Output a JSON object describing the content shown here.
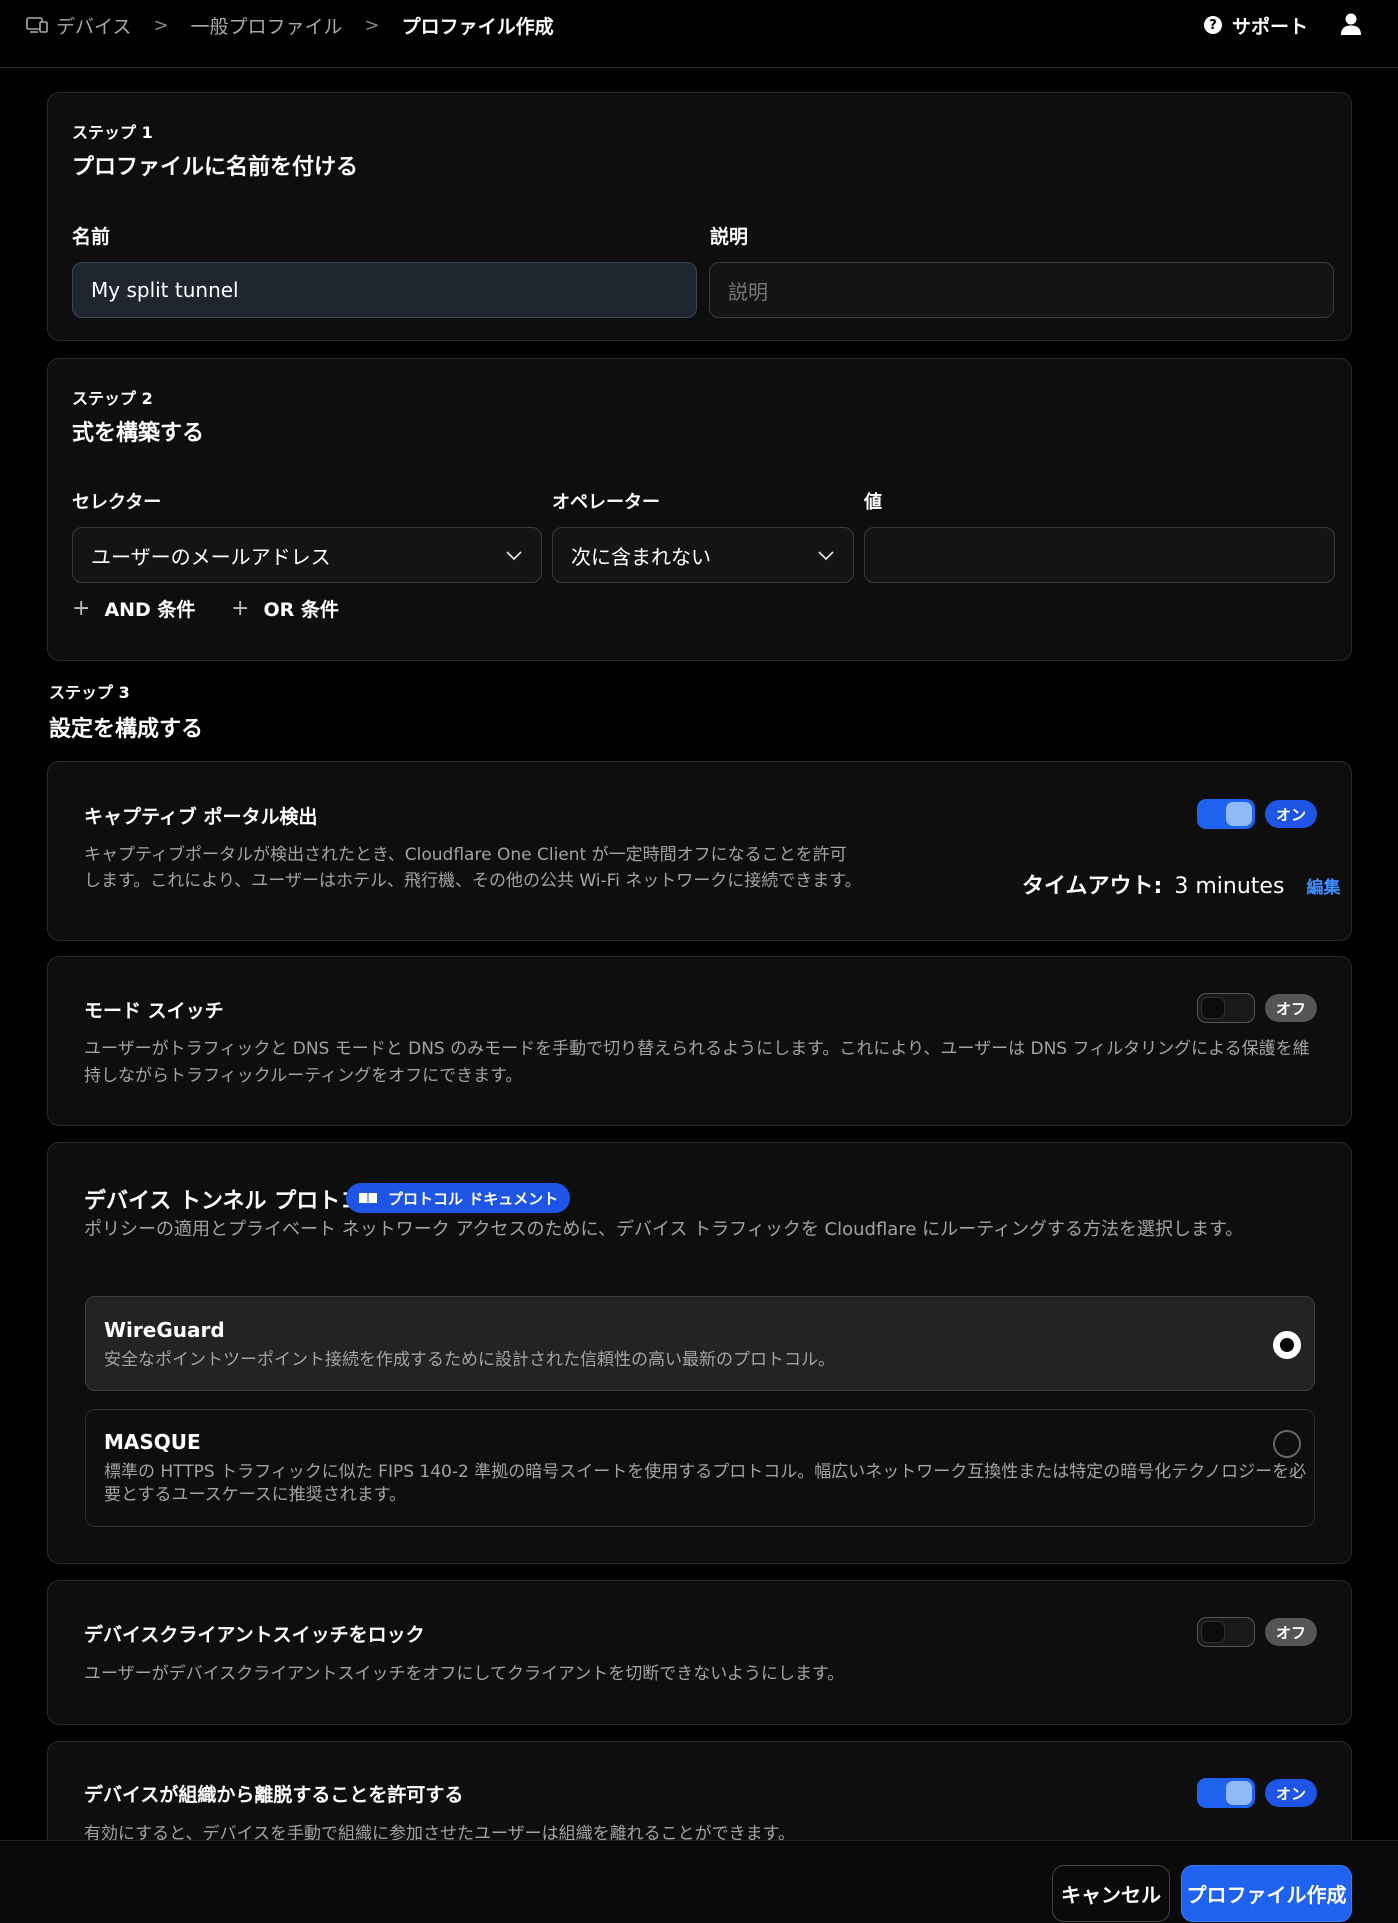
{
  "breadcrumb": {
    "items": [
      "デバイス",
      "一般プロファイル",
      "プロファイル作成"
    ],
    "separator": ">"
  },
  "header": {
    "support_label": "サポート",
    "support_icon": "?"
  },
  "step1": {
    "label": "ステップ 1",
    "title": "プロファイルに名前を付ける",
    "name_label": "名前",
    "name_value": "My split tunnel",
    "desc_label": "説明",
    "desc_placeholder": "説明"
  },
  "step2": {
    "label": "ステップ 2",
    "title": "式を構築する",
    "selector_label": "セレクター",
    "selector_value": "ユーザーのメールアドレス",
    "operator_label": "オペレーター",
    "operator_value": "次に含まれない",
    "value_label": "値",
    "value_value": "",
    "and_label": "AND 条件",
    "or_label": "OR 条件",
    "plus": "+"
  },
  "step3": {
    "label": "ステップ 3",
    "title": "設定を構成する"
  },
  "captive": {
    "title": "キャプティブ ポータル検出",
    "desc_line1": "キャプティブポータルが検出されたとき、Cloudflare One Client が一定時間オフになることを許可",
    "desc_line2": "します。これにより、ユーザーはホテル、飛行機、その他の公共 Wi-Fi ネットワークに接続できます。",
    "state": "オン",
    "timeout_label": "タイムアウト:",
    "timeout_value": "3 minutes",
    "edit_label": "編集"
  },
  "mode_switch": {
    "title": "モード スイッチ",
    "desc_line1": "ユーザーがトラフィックと DNS モードと DNS のみモードを手動で切り替えられるようにします。これにより、ユーザーは DNS フィルタリングによる保護を維",
    "desc_line2": "持しながらトラフィックルーティングをオフにできます。",
    "state": "オフ"
  },
  "protocol": {
    "title": "デバイス トンネル プロトコル",
    "doc_badge": "プロトコル ドキュメント",
    "desc": "ポリシーの適用とプライベート ネットワーク アクセスのために、デバイス トラフィックを Cloudflare にルーティングする方法を選択します。",
    "options": [
      {
        "name": "WireGuard",
        "desc_line1": "安全なポイントツーポイント接続を作成するために設計された信頼性の高い最新のプロトコル。",
        "desc_line2": "",
        "selected": true
      },
      {
        "name": "MASQUE",
        "desc_line1": "標準の HTTPS トラフィックに似た FIPS 140-2 準拠の暗号スイートを使用するプロトコル。幅広いネットワーク互換性または特定の暗号化テクノロジーを必",
        "desc_line2": "要とするユースケースに推奨されます。",
        "selected": false
      }
    ]
  },
  "lock_switch": {
    "title": "デバイスクライアントスイッチをロック",
    "desc": "ユーザーがデバイスクライアントスイッチをオフにしてクライアントを切断できないようにします。",
    "state": "オフ"
  },
  "leave_org": {
    "title": "デバイスが組織から離脱することを許可する",
    "desc": "有効にすると、デバイスを手動で組織に参加させたユーザーは組織を離れることができます。",
    "state": "オン"
  },
  "footer": {
    "cancel_label": "キャンセル",
    "create_label": "プロファイル作成"
  },
  "colors": {
    "accent": "#1f62f0",
    "link": "#3f8cff",
    "background": "#000000",
    "card": "#0e0e0e"
  },
  "icons": [
    "device-icon",
    "chevron-right-icon",
    "help-icon",
    "user-icon",
    "chevron-down-icon",
    "plus-icon",
    "book-icon"
  ]
}
